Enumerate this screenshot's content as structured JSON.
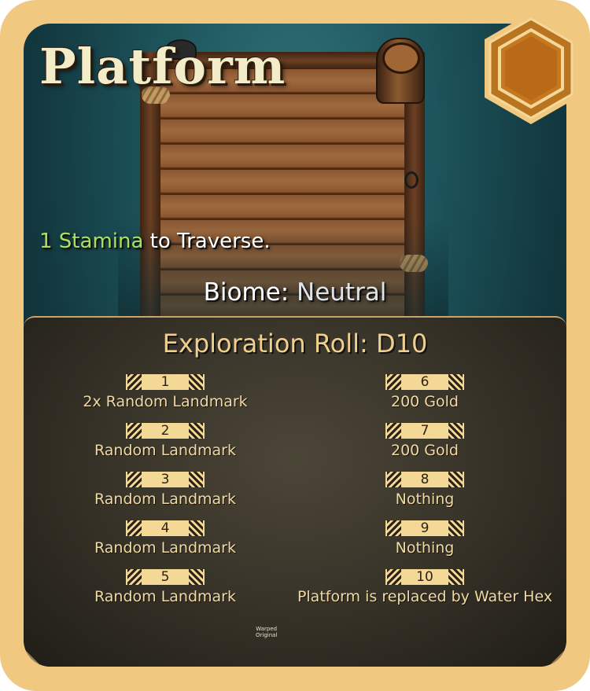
{
  "card": {
    "title": "Platform",
    "traverse": {
      "cost": "1 Stamina",
      "suffix": " to Traverse."
    },
    "biome": {
      "label": "Biome: ",
      "value": "Neutral"
    },
    "exploration_title": "Exploration Roll: D10",
    "rolls_left": [
      {
        "number": "1",
        "result": "2x Random Landmark"
      },
      {
        "number": "2",
        "result": "Random Landmark"
      },
      {
        "number": "3",
        "result": "Random Landmark"
      },
      {
        "number": "4",
        "result": "Random Landmark"
      },
      {
        "number": "5",
        "result": "Random Landmark"
      }
    ],
    "rolls_right": [
      {
        "number": "6",
        "result": "200 Gold"
      },
      {
        "number": "7",
        "result": "200 Gold"
      },
      {
        "number": "8",
        "result": "Nothing"
      },
      {
        "number": "9",
        "result": "Nothing"
      },
      {
        "number": "10",
        "result": "Platform is replaced by Water Hex"
      }
    ],
    "logo": {
      "line1": "Warped",
      "line2": "Original"
    }
  },
  "colors": {
    "card_border": "#f0c880",
    "stamina_green": "#a8e060",
    "roll_text": "#f2d9a2",
    "hex_badge": "#c4791f"
  },
  "icons": [
    "hex-frame-icon",
    "warped-logo-icon"
  ]
}
